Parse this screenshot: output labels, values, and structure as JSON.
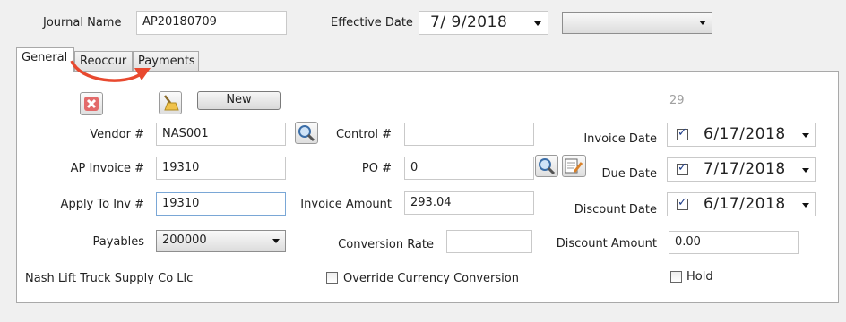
{
  "header": {
    "journal_name_label": "Journal Name",
    "journal_name_value": "AP20180709",
    "effective_date_label": "Effective Date",
    "effective_date_value": "7/  9/2018",
    "extra_combo_value": ""
  },
  "tabs": [
    {
      "label": "General"
    },
    {
      "label": "Reoccur"
    },
    {
      "label": "Payments"
    }
  ],
  "toolbar": {
    "delete_icon": "delete-x-icon",
    "clear_icon": "broom-icon",
    "new_label": "New",
    "record_count": "29"
  },
  "form": {
    "vendor_label": "Vendor #",
    "vendor_value": "NAS001",
    "ap_invoice_label": "AP Invoice #",
    "ap_invoice_value": "19310",
    "apply_to_inv_label": "Apply To Inv #",
    "apply_to_inv_value": "19310",
    "payables_label": "Payables",
    "payables_value": "200000",
    "vendor_name": "Nash Lift Truck Supply Co Llc",
    "control_label": "Control #",
    "control_value": "",
    "po_label": "PO #",
    "po_value": "0",
    "invoice_amount_label": "Invoice Amount",
    "invoice_amount_value": "293.04",
    "conversion_rate_label": "Conversion Rate",
    "conversion_rate_value": "",
    "override_currency_label": "Override Currency Conversion",
    "invoice_date_label": "Invoice Date",
    "invoice_date_value": "6/17/2018",
    "due_date_label": "Due Date",
    "due_date_value": "7/17/2018",
    "discount_date_label": "Discount Date",
    "discount_date_value": "6/17/2018",
    "discount_amount_label": "Discount Amount",
    "discount_amount_value": "0.00",
    "hold_label": "Hold"
  },
  "colors": {
    "annotation_arrow": "#e8492f"
  }
}
